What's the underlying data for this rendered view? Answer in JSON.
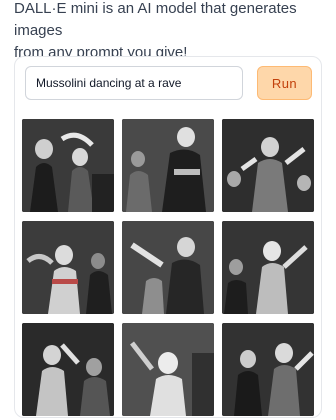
{
  "intro": {
    "line1": "DALL·E mini is an AI model that generates images",
    "line2": "from any prompt you give!"
  },
  "prompt": {
    "value": "Mussolini dancing at a rave"
  },
  "run_label": "Run",
  "colors": {
    "run_bg": "#fed7aa",
    "run_text": "#c2410c",
    "border": "#e5e7eb"
  },
  "results": {
    "image_count": 9,
    "style": "black-and-white photo"
  }
}
